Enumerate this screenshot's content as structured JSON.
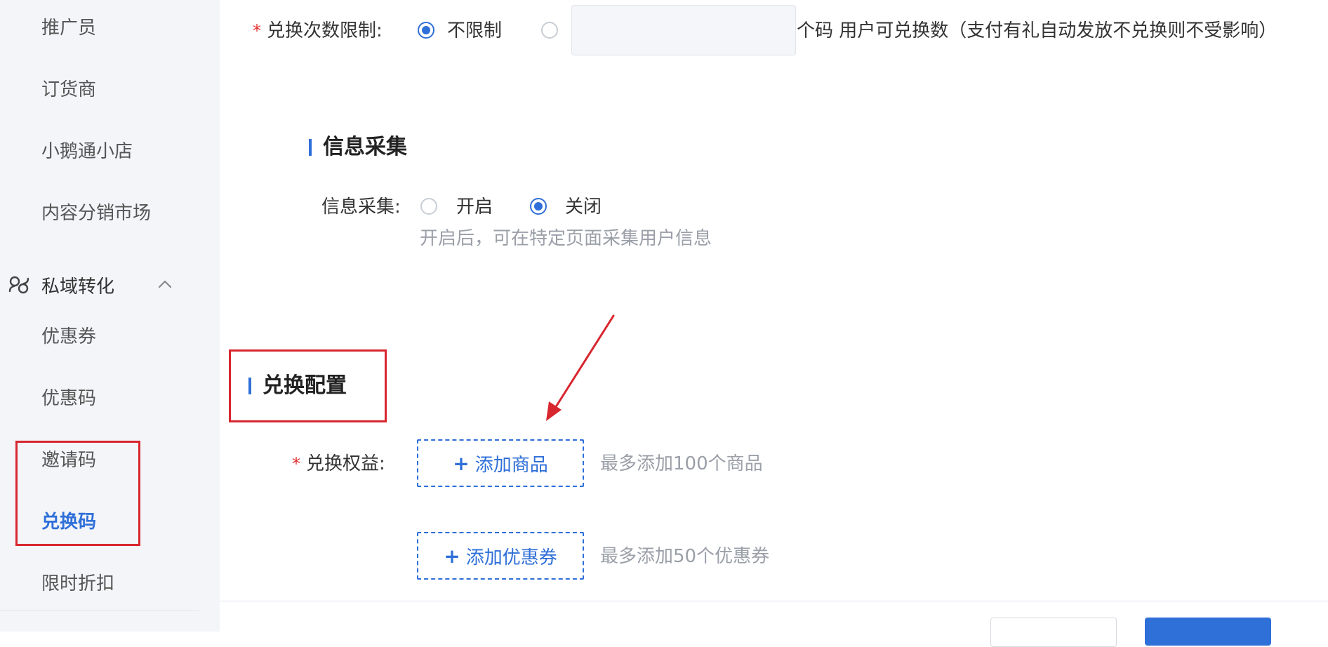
{
  "sidebar": {
    "items_top": [
      {
        "label": "推广员"
      },
      {
        "label": "订货商"
      },
      {
        "label": "小鹅通小店"
      },
      {
        "label": "内容分销市场"
      }
    ],
    "group": {
      "label": "私域转化",
      "icon": "private-domain-icon",
      "expanded": true
    },
    "group_items": [
      {
        "label": "优惠券"
      },
      {
        "label": "优惠码"
      },
      {
        "label": "邀请码"
      },
      {
        "label": "兑换码",
        "active": true
      },
      {
        "label": "限时折扣"
      }
    ]
  },
  "exchange_limit": {
    "label": "兑换次数限制:",
    "option_unlimited": "不限制",
    "count_value": "",
    "suffix": "个码 用户可兑换数（支付有礼自动发放不兑换则不受影响）"
  },
  "info_collect": {
    "section_title": "信息采集",
    "label": "信息采集:",
    "option_on": "开启",
    "option_off": "关闭",
    "selected": "关闭",
    "hint": "开启后，可在特定页面采集用户信息"
  },
  "exchange_config": {
    "section_title": "兑换配置",
    "label": "兑换权益:",
    "add_product": "添加商品",
    "add_product_hint": "最多添加100个商品",
    "add_coupon": "添加优惠券",
    "add_coupon_hint": "最多添加50个优惠券"
  },
  "colors": {
    "accent": "#2f6fd8",
    "annotation": "#d8262f",
    "sidebar_bg": "#f3f5f9"
  }
}
